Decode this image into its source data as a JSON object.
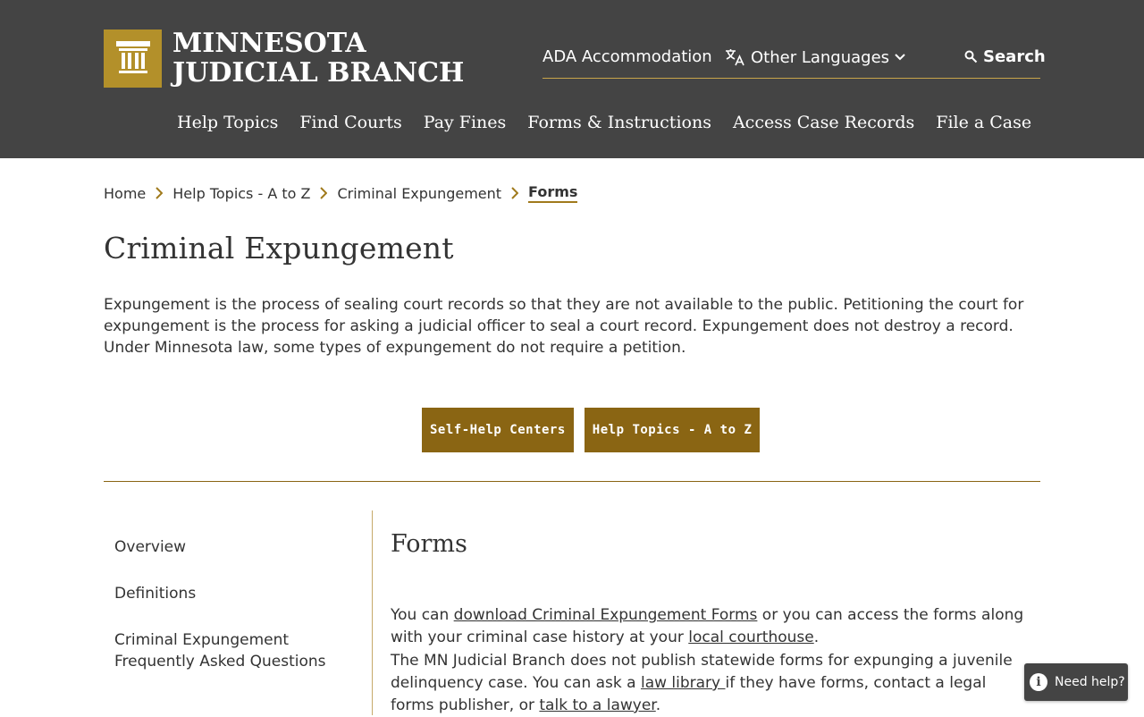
{
  "header": {
    "logo_line1": "MINNESOTA",
    "logo_line2": "JUDICIAL BRANCH",
    "utility": {
      "ada": "ADA Accommodation",
      "languages": "Other Languages",
      "search": "Search"
    },
    "nav": [
      "Help Topics",
      "Find Courts",
      "Pay Fines",
      "Forms & Instructions",
      "Access Case Records",
      "File a Case"
    ]
  },
  "breadcrumb": [
    "Home",
    "Help Topics - A to Z",
    "Criminal Expungement",
    "Forms"
  ],
  "page": {
    "title": "Criminal Expungement",
    "intro": "Expungement is the process of sealing court records so that they are not available to the public. Petitioning the court for expungement is the process for asking a judicial officer to seal a court record. Expungement does not destroy a record. Under Minnesota law, some types of expungement do not require a petition.",
    "buttons": [
      "Self-Help Centers",
      "Help Topics - A to Z"
    ]
  },
  "sidenav": [
    "Overview",
    "Definitions",
    "Criminal Expungement Frequently Asked Questions"
  ],
  "content": {
    "heading": "Forms",
    "p1": {
      "t1": "You can ",
      "link1": "download Criminal Expungement Forms",
      "t2": " or you can access the forms along with your criminal case history at your ",
      "link2": "local courthouse",
      "t3": "."
    },
    "p2": {
      "t1": "The MN Judicial Branch does not publish statewide forms for expunging a juvenile delinquency case. You can ask a ",
      "link1": "law library ",
      "t2": "if they have forms, contact a legal forms publisher, or ",
      "link2": "talk to a lawyer",
      "t3": "."
    }
  },
  "help_widget": {
    "icon": "i",
    "label": "Need help?"
  },
  "colors": {
    "header_bg": "#444444",
    "gold": "#8a6513",
    "logo_gold": "#b3902a"
  }
}
